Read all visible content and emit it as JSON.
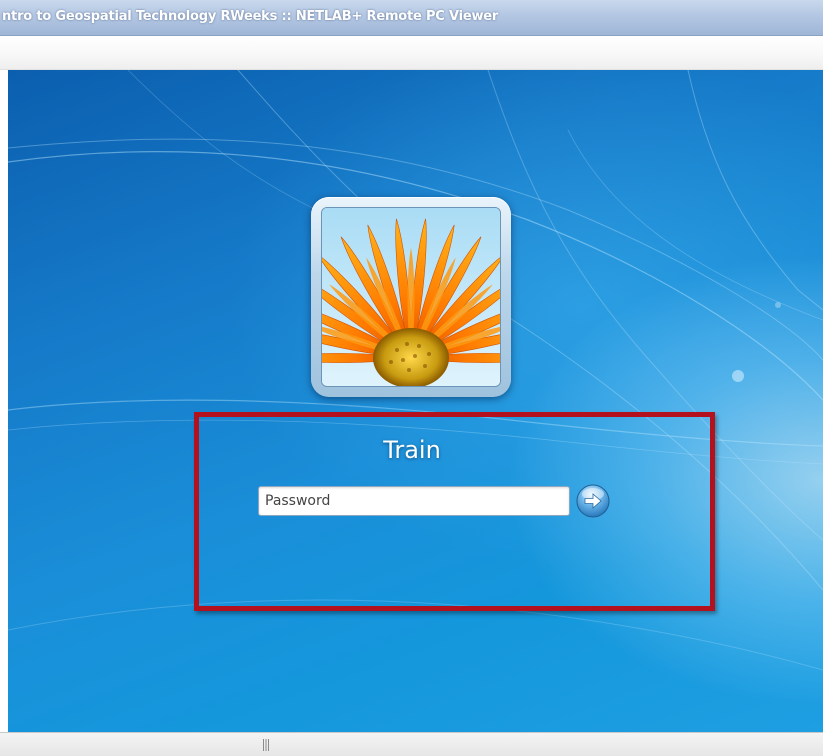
{
  "window": {
    "title": "ntro to Geospatial Technology RWeeks :: NETLAB+ Remote PC Viewer"
  },
  "login": {
    "username": "Train",
    "password_placeholder": "Password",
    "avatar_icon": "flower-icon",
    "submit_icon": "arrow-right-icon"
  },
  "colors": {
    "desktop_blue": "#1a8ed8",
    "highlight_red": "#b2111d",
    "titlebar_blue": "#b3c7e3"
  }
}
